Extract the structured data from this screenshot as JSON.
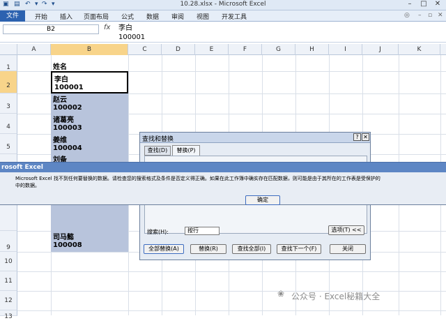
{
  "window": {
    "title": "10.28.xlsx - Microsoft Excel",
    "min": "–",
    "restore": "□",
    "close": "✕"
  },
  "ribbon": {
    "tabs": [
      "文件",
      "开始",
      "插入",
      "页面布局",
      "公式",
      "数据",
      "审阅",
      "视图",
      "开发工具"
    ]
  },
  "formula_bar": {
    "name_box": "B2",
    "fx": "fx",
    "value_line1": "李白",
    "value_line2": "100001"
  },
  "columns": [
    "A",
    "B",
    "C",
    "D",
    "E",
    "F",
    "G",
    "H",
    "I",
    "J",
    "K"
  ],
  "rows": [
    "1",
    "2",
    "3",
    "4",
    "5",
    "9",
    "10",
    "11",
    "12",
    "13"
  ],
  "cells": {
    "header": "姓名",
    "r2a": "李白",
    "r2b": "100001",
    "r3a": "赵云",
    "r3b": "100002",
    "r4a": "诸葛亮",
    "r4b": "100003",
    "r5a": "姜维",
    "r5b": "100004",
    "r6a": "刘备",
    "r9a": "司马懿",
    "r9b": "100008"
  },
  "find_dialog": {
    "title": "查找和替换",
    "help": "?",
    "close": "✕",
    "tabs": [
      "查找(D)",
      "替换(P)"
    ],
    "search_label": "搜索(H):",
    "search_value": "按行",
    "options_button": "选项(T) <<",
    "buttons": [
      "全部替换(A)",
      "替换(R)",
      "查找全部(I)",
      "查找下一个(F)",
      "关闭"
    ]
  },
  "error_dialog": {
    "title": "rosoft Excel",
    "message_line1": "Microsoft Excel 找不到任何要替换的数据。请检查您的搜索格式及条件是否定义得正确。如果在此工作簿中确实存在匹配数据，则可能是由于其所在的工作表是受保护的",
    "message_line2": "中的数据。",
    "ok": "确定"
  },
  "watermark": "公众号 · Excel秘籍大全",
  "colors": {
    "accent": "#2c62b0",
    "selection_header": "#f8d48a",
    "range_fill": "#b8c4dc"
  }
}
